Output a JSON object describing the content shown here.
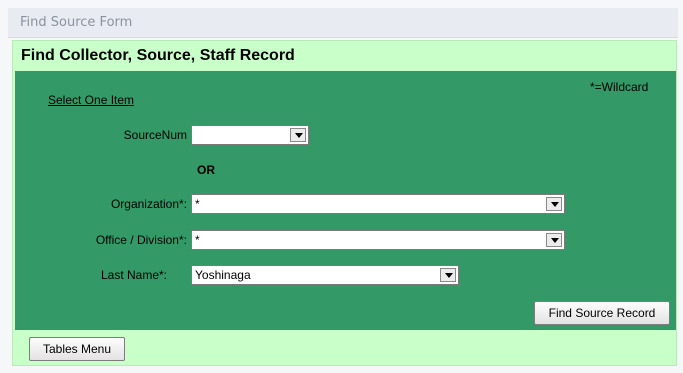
{
  "window": {
    "title": "Find Source Form"
  },
  "form": {
    "header": "Find Collector, Source, Staff Record",
    "select_one": "Select One Item",
    "wildcard_note": "*=Wildcard",
    "or_label": "OR",
    "fields": {
      "source_num": {
        "label": "SourceNum",
        "value": ""
      },
      "organization": {
        "label": "Organization*:",
        "value": "*"
      },
      "office_division": {
        "label": "Office / Division*:",
        "value": "*"
      },
      "last_name": {
        "label": "Last Name*:",
        "value": "Yoshinaga"
      }
    },
    "find_button": "Find Source Record",
    "tables_menu_button": "Tables Menu"
  },
  "colors": {
    "detail_bg": "#339966",
    "frame_bg": "#c9ffc9",
    "title_bar_bg": "#e8ebf1"
  },
  "icons": {
    "dropdown": "chevron-down-icon"
  }
}
